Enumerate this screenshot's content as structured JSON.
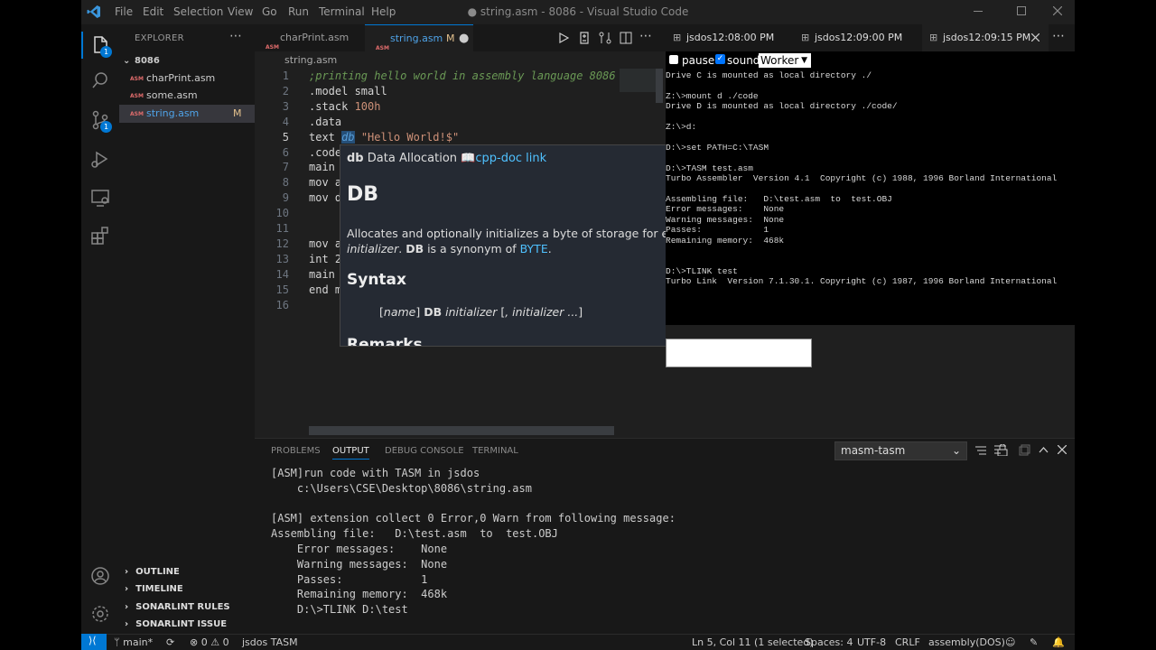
{
  "window": {
    "title": "● string.asm - 8086 - Visual Studio Code",
    "menu": [
      "File",
      "Edit",
      "Selection",
      "View",
      "Go",
      "Run",
      "Terminal",
      "Help"
    ]
  },
  "activity_bar": {
    "icons": [
      "explorer-icon",
      "search-icon",
      "source-control-icon",
      "run-debug-icon",
      "remote-explorer-icon",
      "extensions-icon",
      "account-icon",
      "manage-gear-icon"
    ],
    "explorer_badge": "1",
    "scm_badge": "1"
  },
  "sidebar": {
    "title": "EXPLORER",
    "folder": "8086",
    "files": [
      {
        "name": "charPrint.asm",
        "status": ""
      },
      {
        "name": "some.asm",
        "status": ""
      },
      {
        "name": "string.asm",
        "status": "M"
      }
    ],
    "file_badge": "ASM",
    "sections": [
      "OUTLINE",
      "TIMELINE",
      "SONARLINT RULES",
      "SONARLINT ISSUE LOCATI..."
    ]
  },
  "editor": {
    "tabs": [
      {
        "label": "charPrint.asm",
        "active": false
      },
      {
        "label": "string.asm",
        "status": "M",
        "active": true
      }
    ],
    "breadcrumb": "string.asm",
    "lines": [
      {
        "n": "1",
        "text": ";printing hello world in assembly language 8086"
      },
      {
        "n": "2",
        "text": ".model small"
      },
      {
        "n": "3",
        "text": ".stack 100h"
      },
      {
        "n": "4",
        "text": ".data"
      },
      {
        "n": "5",
        "text": "text db \"Hello World!$\""
      },
      {
        "n": "6",
        "text": ".code"
      },
      {
        "n": "7",
        "text": "main"
      },
      {
        "n": "8",
        "text": "mov a"
      },
      {
        "n": "9",
        "text": "mov d"
      },
      {
        "n": "10",
        "text": ""
      },
      {
        "n": "11",
        "text": ""
      },
      {
        "n": "12",
        "text": "mov a"
      },
      {
        "n": "13",
        "text": "int 2"
      },
      {
        "n": "14",
        "text": "main"
      },
      {
        "n": "15",
        "text": "end m"
      },
      {
        "n": "16",
        "text": ""
      }
    ]
  },
  "hover": {
    "keyword": "db",
    "kind": "Data Allocation",
    "doc_link": "cpp-doc link",
    "heading": "DB",
    "desc_1": "Allocates and optionally initializes a byte of storage for each ",
    "desc_italic": "initializer",
    "desc_2": ". ",
    "desc_bold": "DB",
    "desc_3": " is a synonym of ",
    "desc_link": "BYTE",
    "desc_4": ".",
    "syntax_heading": "Syntax",
    "syntax_name": "name",
    "syntax_db": "DB",
    "syntax_init": "initializer",
    "syntax_more": ", initializer ...",
    "remarks_heading": "Remarks"
  },
  "right_pane": {
    "tabs": [
      "jsdos12:08:00 PM",
      "jsdos12:09:00 PM",
      "jsdos12:09:15 PM"
    ],
    "pause_label": "pause",
    "sound_label": "sound",
    "mode_value": "Worker",
    "dos_lines": [
      "Drive C is mounted as local directory ./",
      "",
      "Z:\\>mount d ./code",
      "Drive D is mounted as local directory ./code/",
      "",
      "Z:\\>d:",
      "",
      "D:\\>set PATH=C:\\TASM",
      "",
      "D:\\>TASM test.asm",
      "Turbo Assembler  Version 4.1  Copyright (c) 1988, 1996 Borland International",
      "",
      "Assembling file:   D:\\test.asm  to  test.OBJ",
      "Error messages:    None",
      "Warning messages:  None",
      "Passes:            1",
      "Remaining memory:  468k",
      "",
      "",
      "D:\\>TLINK test",
      "Turbo Link  Version 7.1.30.1. Copyright (c) 1987, 1996 Borland International"
    ]
  },
  "panel": {
    "tabs": [
      "PROBLEMS",
      "OUTPUT",
      "DEBUG CONSOLE",
      "TERMINAL"
    ],
    "channel": "masm-tasm",
    "lines": [
      "[ASM]run code with TASM in jsdos",
      "    c:\\Users\\CSE\\Desktop\\8086\\string.asm",
      "",
      "[ASM] extension collect 0 Error,0 Warn from following message:",
      "Assembling file:   D:\\test.asm  to  test.OBJ",
      "    Error messages:    None",
      "    Warning messages:  None",
      "    Passes:            1",
      "    Remaining memory:  468k",
      "    D:\\>TLINK D:\\test"
    ]
  },
  "status_bar": {
    "branch": "main*",
    "errors": "0",
    "warnings": "0",
    "jsdos": "jsdos TASM",
    "cursor": "Ln 5, Col 11 (1 selected)",
    "spaces": "Spaces: 4",
    "encoding": "UTF-8",
    "eol": "CRLF",
    "language": "assembly(DOS)"
  },
  "colors": {
    "accent": "#0078d4",
    "link": "#4fc1ff",
    "keyword_db": "#569cd6",
    "number": "#ce9178",
    "comment": "#6a9955",
    "string": "#ce9178"
  }
}
